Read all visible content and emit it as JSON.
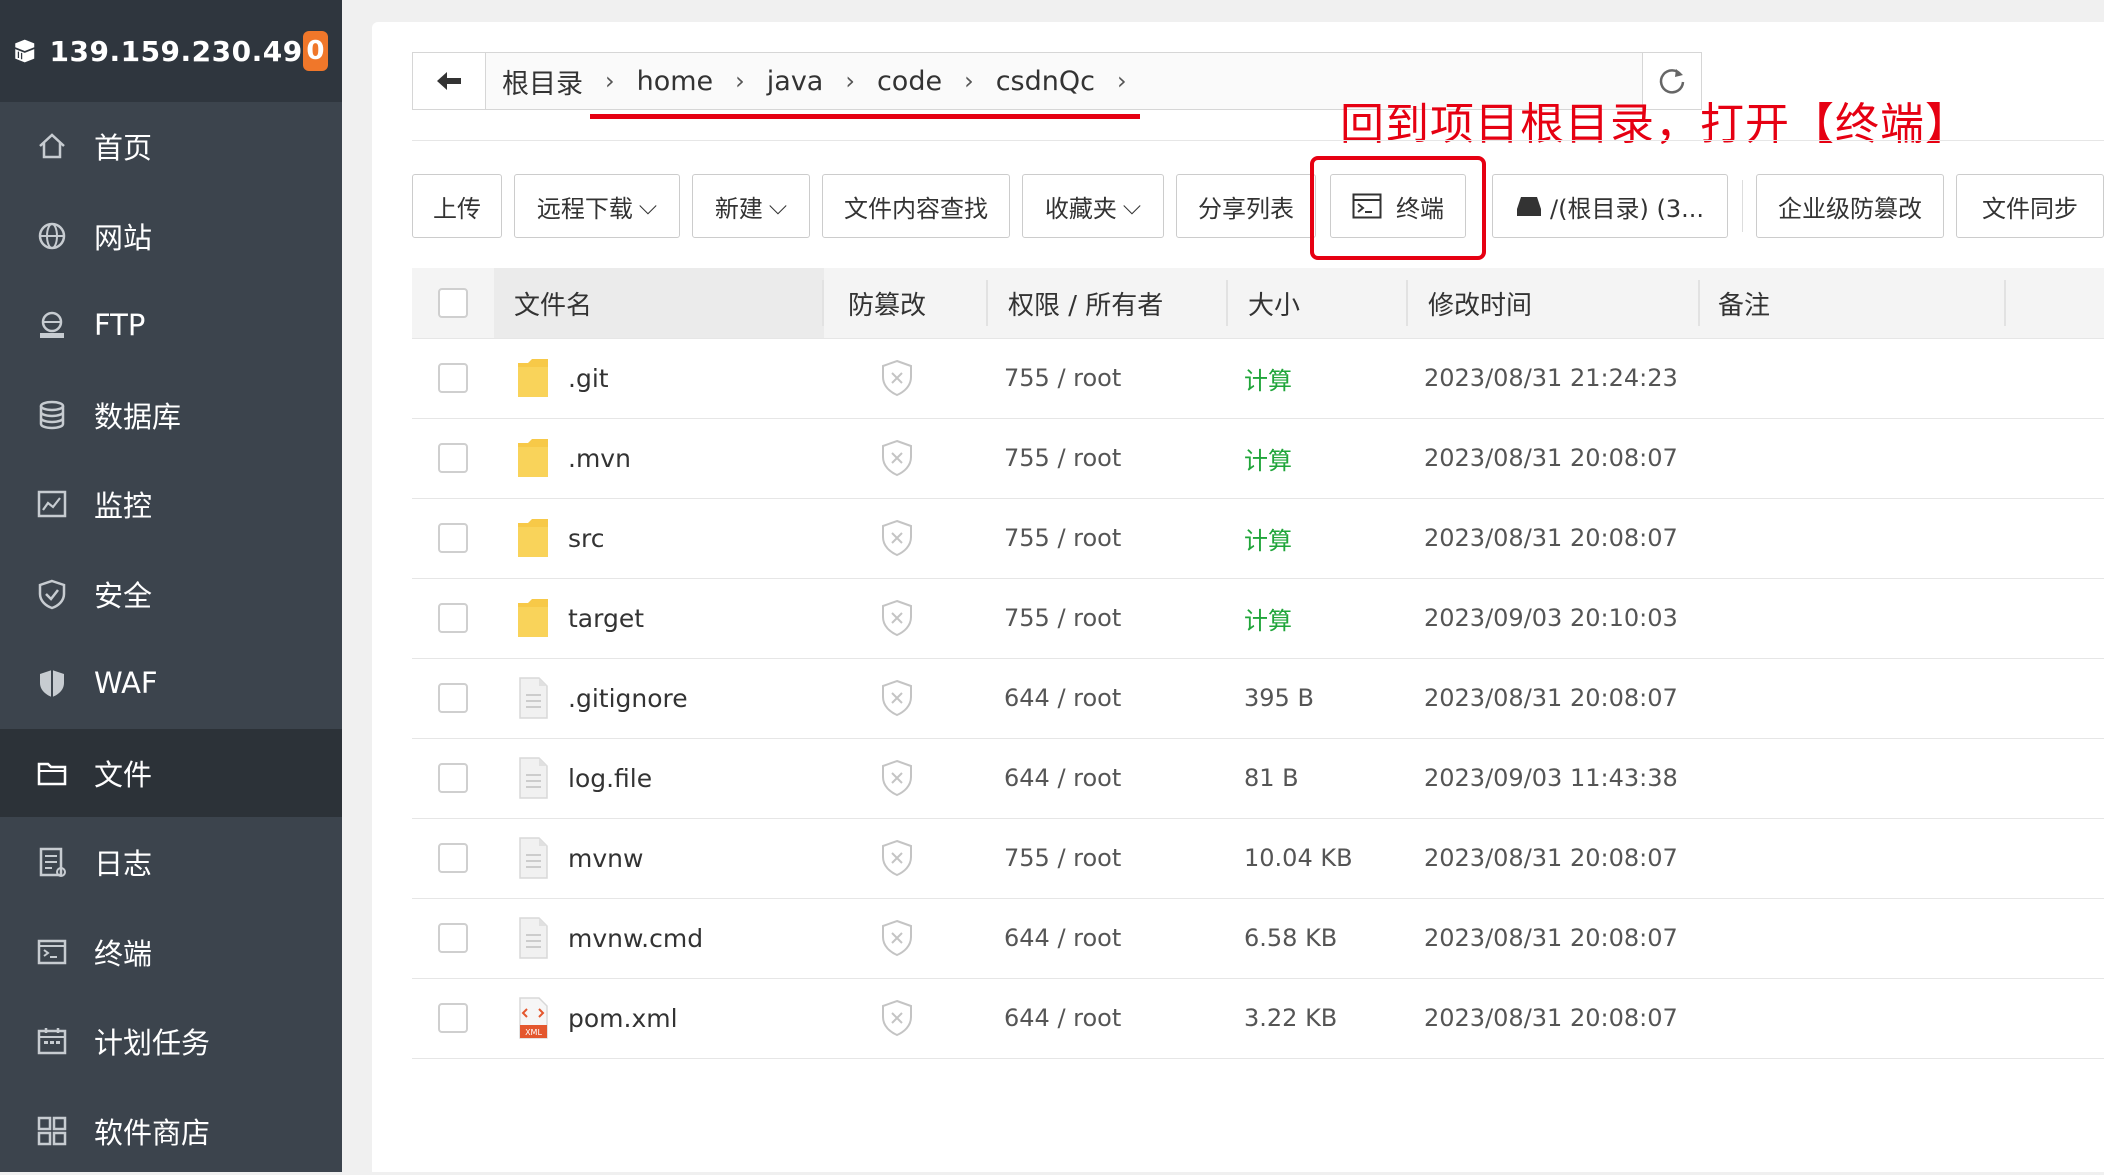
{
  "sidebar": {
    "ip": "139.159.230.49",
    "badge": "0",
    "items": [
      {
        "label": "首页",
        "icon": "home-icon"
      },
      {
        "label": "网站",
        "icon": "globe-icon"
      },
      {
        "label": "FTP",
        "icon": "ftp-icon"
      },
      {
        "label": "数据库",
        "icon": "database-icon"
      },
      {
        "label": "监控",
        "icon": "monitor-icon"
      },
      {
        "label": "安全",
        "icon": "shield-check-icon"
      },
      {
        "label": "WAF",
        "icon": "waf-shield-icon"
      },
      {
        "label": "文件",
        "icon": "folder-icon",
        "active": true
      },
      {
        "label": "日志",
        "icon": "log-icon"
      },
      {
        "label": "终端",
        "icon": "terminal-icon"
      },
      {
        "label": "计划任务",
        "icon": "calendar-icon"
      },
      {
        "label": "软件商店",
        "icon": "apps-icon"
      }
    ]
  },
  "breadcrumb": [
    "根目录",
    "home",
    "java",
    "code",
    "csdnQc"
  ],
  "annotation": "回到项目根目录，打开【终端】",
  "toolbar": {
    "upload": "上传",
    "remote_download": "远程下载",
    "new": "新建",
    "search_content": "文件内容查找",
    "favorites": "收藏夹",
    "share_list": "分享列表",
    "terminal": "终端",
    "disk": "/(根目录) (3...",
    "tamper": "企业级防篡改",
    "sync": "文件同步"
  },
  "table": {
    "headers": {
      "name": "文件名",
      "tamper": "防篡改",
      "perm": "权限 / 所有者",
      "size": "大小",
      "mtime": "修改时间",
      "note": "备注"
    },
    "rows": [
      {
        "name": ".git",
        "type": "folder",
        "perm": "755 / root",
        "size": "计算",
        "calc": true,
        "mtime": "2023/08/31 21:24:23"
      },
      {
        "name": ".mvn",
        "type": "folder",
        "perm": "755 / root",
        "size": "计算",
        "calc": true,
        "mtime": "2023/08/31 20:08:07"
      },
      {
        "name": "src",
        "type": "folder",
        "perm": "755 / root",
        "size": "计算",
        "calc": true,
        "mtime": "2023/08/31 20:08:07"
      },
      {
        "name": "target",
        "type": "folder",
        "perm": "755 / root",
        "size": "计算",
        "calc": true,
        "mtime": "2023/09/03 20:10:03"
      },
      {
        "name": ".gitignore",
        "type": "file",
        "perm": "644 / root",
        "size": "395 B",
        "calc": false,
        "mtime": "2023/08/31 20:08:07"
      },
      {
        "name": "log.file",
        "type": "file",
        "perm": "644 / root",
        "size": "81 B",
        "calc": false,
        "mtime": "2023/09/03 11:43:38"
      },
      {
        "name": "mvnw",
        "type": "file",
        "perm": "755 / root",
        "size": "10.04 KB",
        "calc": false,
        "mtime": "2023/08/31 20:08:07"
      },
      {
        "name": "mvnw.cmd",
        "type": "file",
        "perm": "644 / root",
        "size": "6.58 KB",
        "calc": false,
        "mtime": "2023/08/31 20:08:07"
      },
      {
        "name": "pom.xml",
        "type": "xml",
        "perm": "644 / root",
        "size": "3.22 KB",
        "calc": false,
        "mtime": "2023/08/31 20:08:07"
      }
    ]
  },
  "colors": {
    "accent_green": "#20a53a",
    "annotation_red": "#e60012",
    "sidebar_bg": "#3c444d",
    "badge_orange": "#f0772a"
  }
}
